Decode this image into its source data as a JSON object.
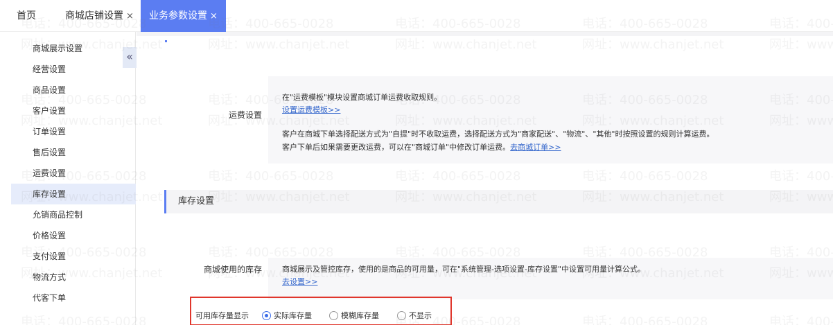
{
  "tabs": [
    {
      "label": "首页",
      "closable": false
    },
    {
      "label": "商城店铺设置",
      "closable": true
    },
    {
      "label": "业务参数设置",
      "closable": true
    }
  ],
  "close_glyph": "×",
  "sidebar": {
    "collapse_glyph": "«",
    "items": [
      {
        "label": "商城展示设置"
      },
      {
        "label": "经营设置"
      },
      {
        "label": "商品设置"
      },
      {
        "label": "客户设置"
      },
      {
        "label": "订单设置"
      },
      {
        "label": "售后设置"
      },
      {
        "label": "运费设置"
      },
      {
        "label": "库存设置",
        "active": true
      },
      {
        "label": "允销商品控制"
      },
      {
        "label": "价格设置"
      },
      {
        "label": "支付设置"
      },
      {
        "label": "物流方式"
      },
      {
        "label": "代客下单"
      }
    ]
  },
  "freight": {
    "label": "运费设置",
    "line1": "在\"运费模板\"模块设置商城订单运费收取规则。",
    "link1": "设置运费模板>>",
    "line2": "客户在商城下单选择配送方式为\"自提\"时不收取运费，选择配送方式为\"商家配送\"、\"物流\"、\"其他\"时按照设置的规则计算运费。",
    "line3": "客户下单后如果需要更改运费，可以在\"商城订单\"中修改订单运费。",
    "link2": "去商城订单>>"
  },
  "inventory": {
    "section_title": "库存设置",
    "stock_label": "商城使用的库存",
    "stock_text": "商城展示及管控库存，使用的是商品的可用量，可在\"系统管理-选项设置-库存设置\"中设置可用量计算公式。",
    "stock_link": "去设置>>",
    "display_label": "可用库存量显示",
    "options": [
      {
        "label": "实际库存量",
        "checked": true
      },
      {
        "label": "模糊库存量",
        "checked": false
      },
      {
        "label": "不显示",
        "checked": false
      }
    ]
  },
  "watermark": {
    "phone": "电话：400-665-0028",
    "site": "网址：www.chanjet.net"
  },
  "colors": {
    "accent": "#5b7df2",
    "link": "#3366cc",
    "highlight": "#e0362c"
  }
}
